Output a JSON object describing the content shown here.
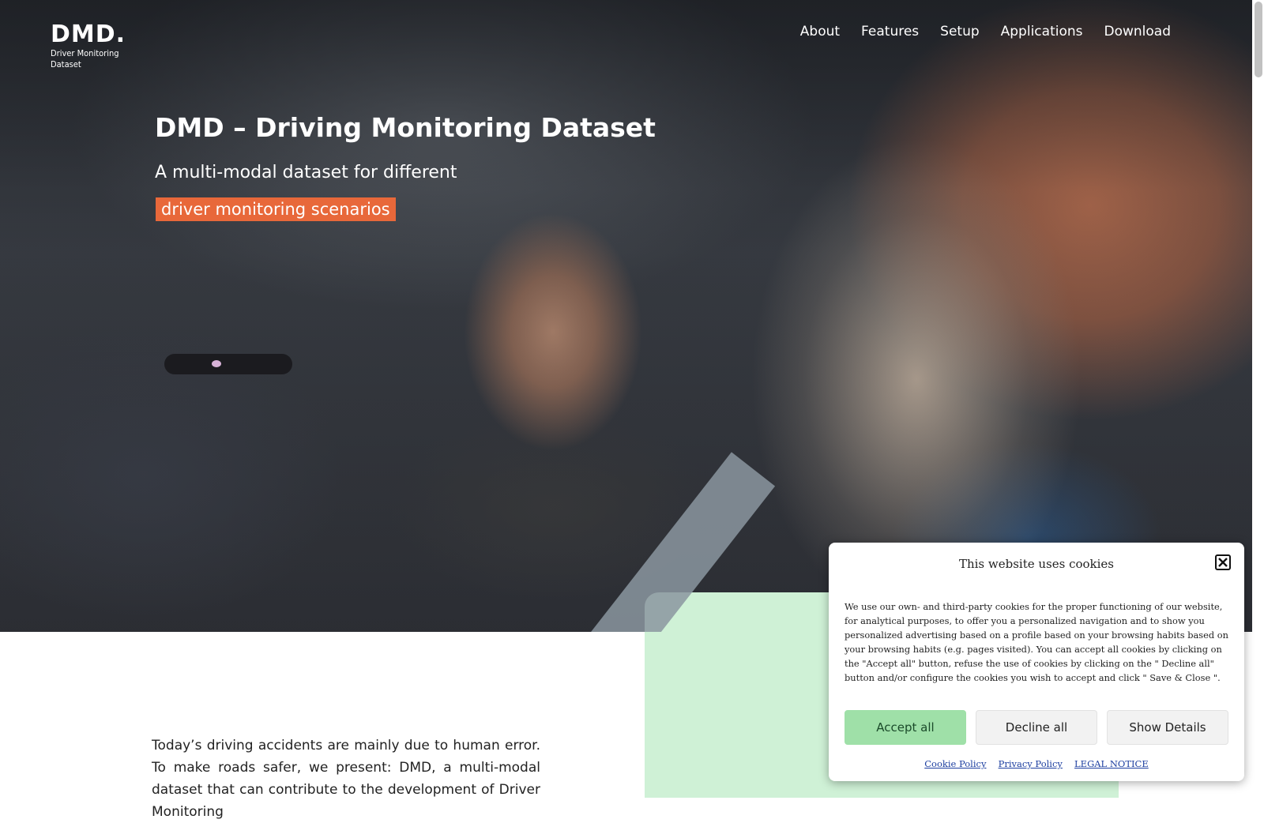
{
  "header": {
    "logo": {
      "mark": "DMD.",
      "line1": "Driver Monitoring",
      "line2": "Dataset"
    },
    "nav": [
      {
        "label": "About"
      },
      {
        "label": "Features"
      },
      {
        "label": "Setup"
      },
      {
        "label": "Applications"
      },
      {
        "label": "Download"
      }
    ]
  },
  "hero": {
    "title": "DMD – Driving Monitoring Dataset",
    "subtitle": "A multi-modal dataset for different",
    "highlight": "driver monitoring scenarios",
    "highlight_color": "#e8683a"
  },
  "intro": {
    "text": "Today’s driving accidents are mainly due to human error. To make roads safer, we present: DMD, a multi-modal dataset that can contribute to the development of Driver Monitoring"
  },
  "cookie_banner": {
    "title": "This website uses cookies",
    "body": "We use our own- and third-party cookies for the proper functioning of our website, for analytical purposes, to offer you a personalized navigation and to show you personalized advertising based on a profile based on your browsing habits based on your browsing habits (e.g. pages visited). You can accept all cookies by clicking on the \"Accept all\" button, refuse the use of cookies by clicking on the \" Decline all\" button and/or configure the cookies you wish to accept and click \" Save & Close \".",
    "accept_label": "Accept all",
    "decline_label": "Decline all",
    "details_label": "Show Details",
    "links": [
      {
        "label": "Cookie Policy"
      },
      {
        "label": "Privacy Policy"
      },
      {
        "label": "LEGAL NOTICE"
      }
    ],
    "accept_color": "#9fe0a8"
  },
  "colors": {
    "green_card": "#cff1d6",
    "link": "#1d3fa0"
  }
}
